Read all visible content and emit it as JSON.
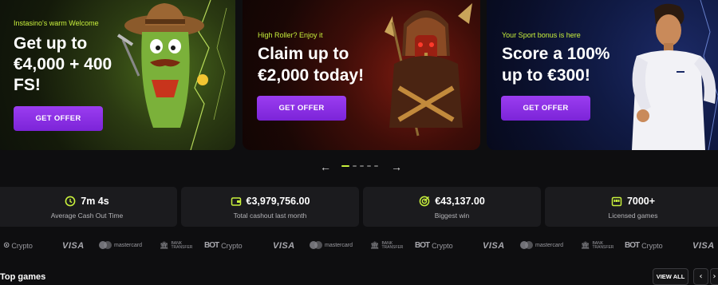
{
  "promos": [
    {
      "eyebrow": "Instasino's warm Welcome",
      "headline": [
        "Get up to",
        "€4,000 + 400",
        "FS!"
      ],
      "button": "GET OFFER"
    },
    {
      "eyebrow": "High Roller? Enjoy it",
      "headline": [
        "Claim up to",
        "€2,000 today!"
      ],
      "button": "GET OFFER"
    },
    {
      "eyebrow": "Your Sport bonus is here",
      "headline": [
        "Score a 100%",
        "up to €300!"
      ],
      "button": "GET OFFER"
    }
  ],
  "carousel": {
    "prev_icon": "chevron-left-icon",
    "next_icon": "chevron-right-icon",
    "dot_count": 5,
    "active_index": 0
  },
  "stats": [
    {
      "icon": "clock-icon",
      "value": "7m 4s",
      "label": "Average Cash Out Time"
    },
    {
      "icon": "wallet-icon",
      "value": "€3,979,756.00",
      "label": "Total cashout last month"
    },
    {
      "icon": "target-icon",
      "value": "€43,137.00",
      "label": "Biggest win"
    },
    {
      "icon": "slot-machine-icon",
      "value": "7000+",
      "label": "Licensed games"
    }
  ],
  "payments": {
    "crypto": "Crypto",
    "visa": "VISA",
    "mastercard": "mastercard",
    "bank_line1": "BANK",
    "bank_line2": "TRANSFER",
    "crypto_logo": "BOT"
  },
  "section": {
    "title": "Top games",
    "view_all": "VIEW ALL",
    "prev": "‹",
    "next": "›"
  },
  "colors": {
    "accent": "#c8f03c",
    "button": "#8a2be2",
    "background": "#0e0e10",
    "stat_bg": "#1b1b1e"
  }
}
